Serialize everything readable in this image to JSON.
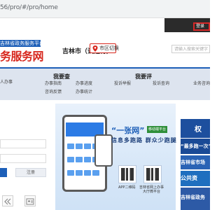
{
  "browser": {
    "url": "56/pro/#/pro/home"
  },
  "topbar": {
    "login_label": "登录"
  },
  "header": {
    "logo_subtitle": "吉林省政务服务平台",
    "logo_title": "务服务网",
    "city": "吉林市（试运行）",
    "switch_label": "市区切换",
    "search_placeholder": "请输入搜索关键字"
  },
  "nav": {
    "sections": [
      {
        "title": "我要查",
        "items": [
          "办事指南",
          "办事进度",
          "咨询反馈",
          "办事统计"
        ]
      },
      {
        "title": "我要评",
        "items": [
          "投诉举报",
          "投诉查询",
          "业务咨询"
        ]
      }
    ],
    "left_item": "人办事"
  },
  "login_panel": {
    "register_label": "注册"
  },
  "banner": {
    "headline": "“一张网”",
    "mobile_tag": "移动端平台",
    "slogan": "信息多跑路 群众少跑腿",
    "qr_captions": [
      "APP二维码",
      "吉林省网上办事\n大厅微平台"
    ]
  },
  "right_column": {
    "top_label": "权",
    "items": [
      "“最多跑一次”",
      "吉林省市场",
      "公共资",
      "吉林省政务"
    ]
  },
  "colors": {
    "accent": "#1d5fb8",
    "brand_red": "#d7261c",
    "nav_bg": "#dde4ef"
  }
}
